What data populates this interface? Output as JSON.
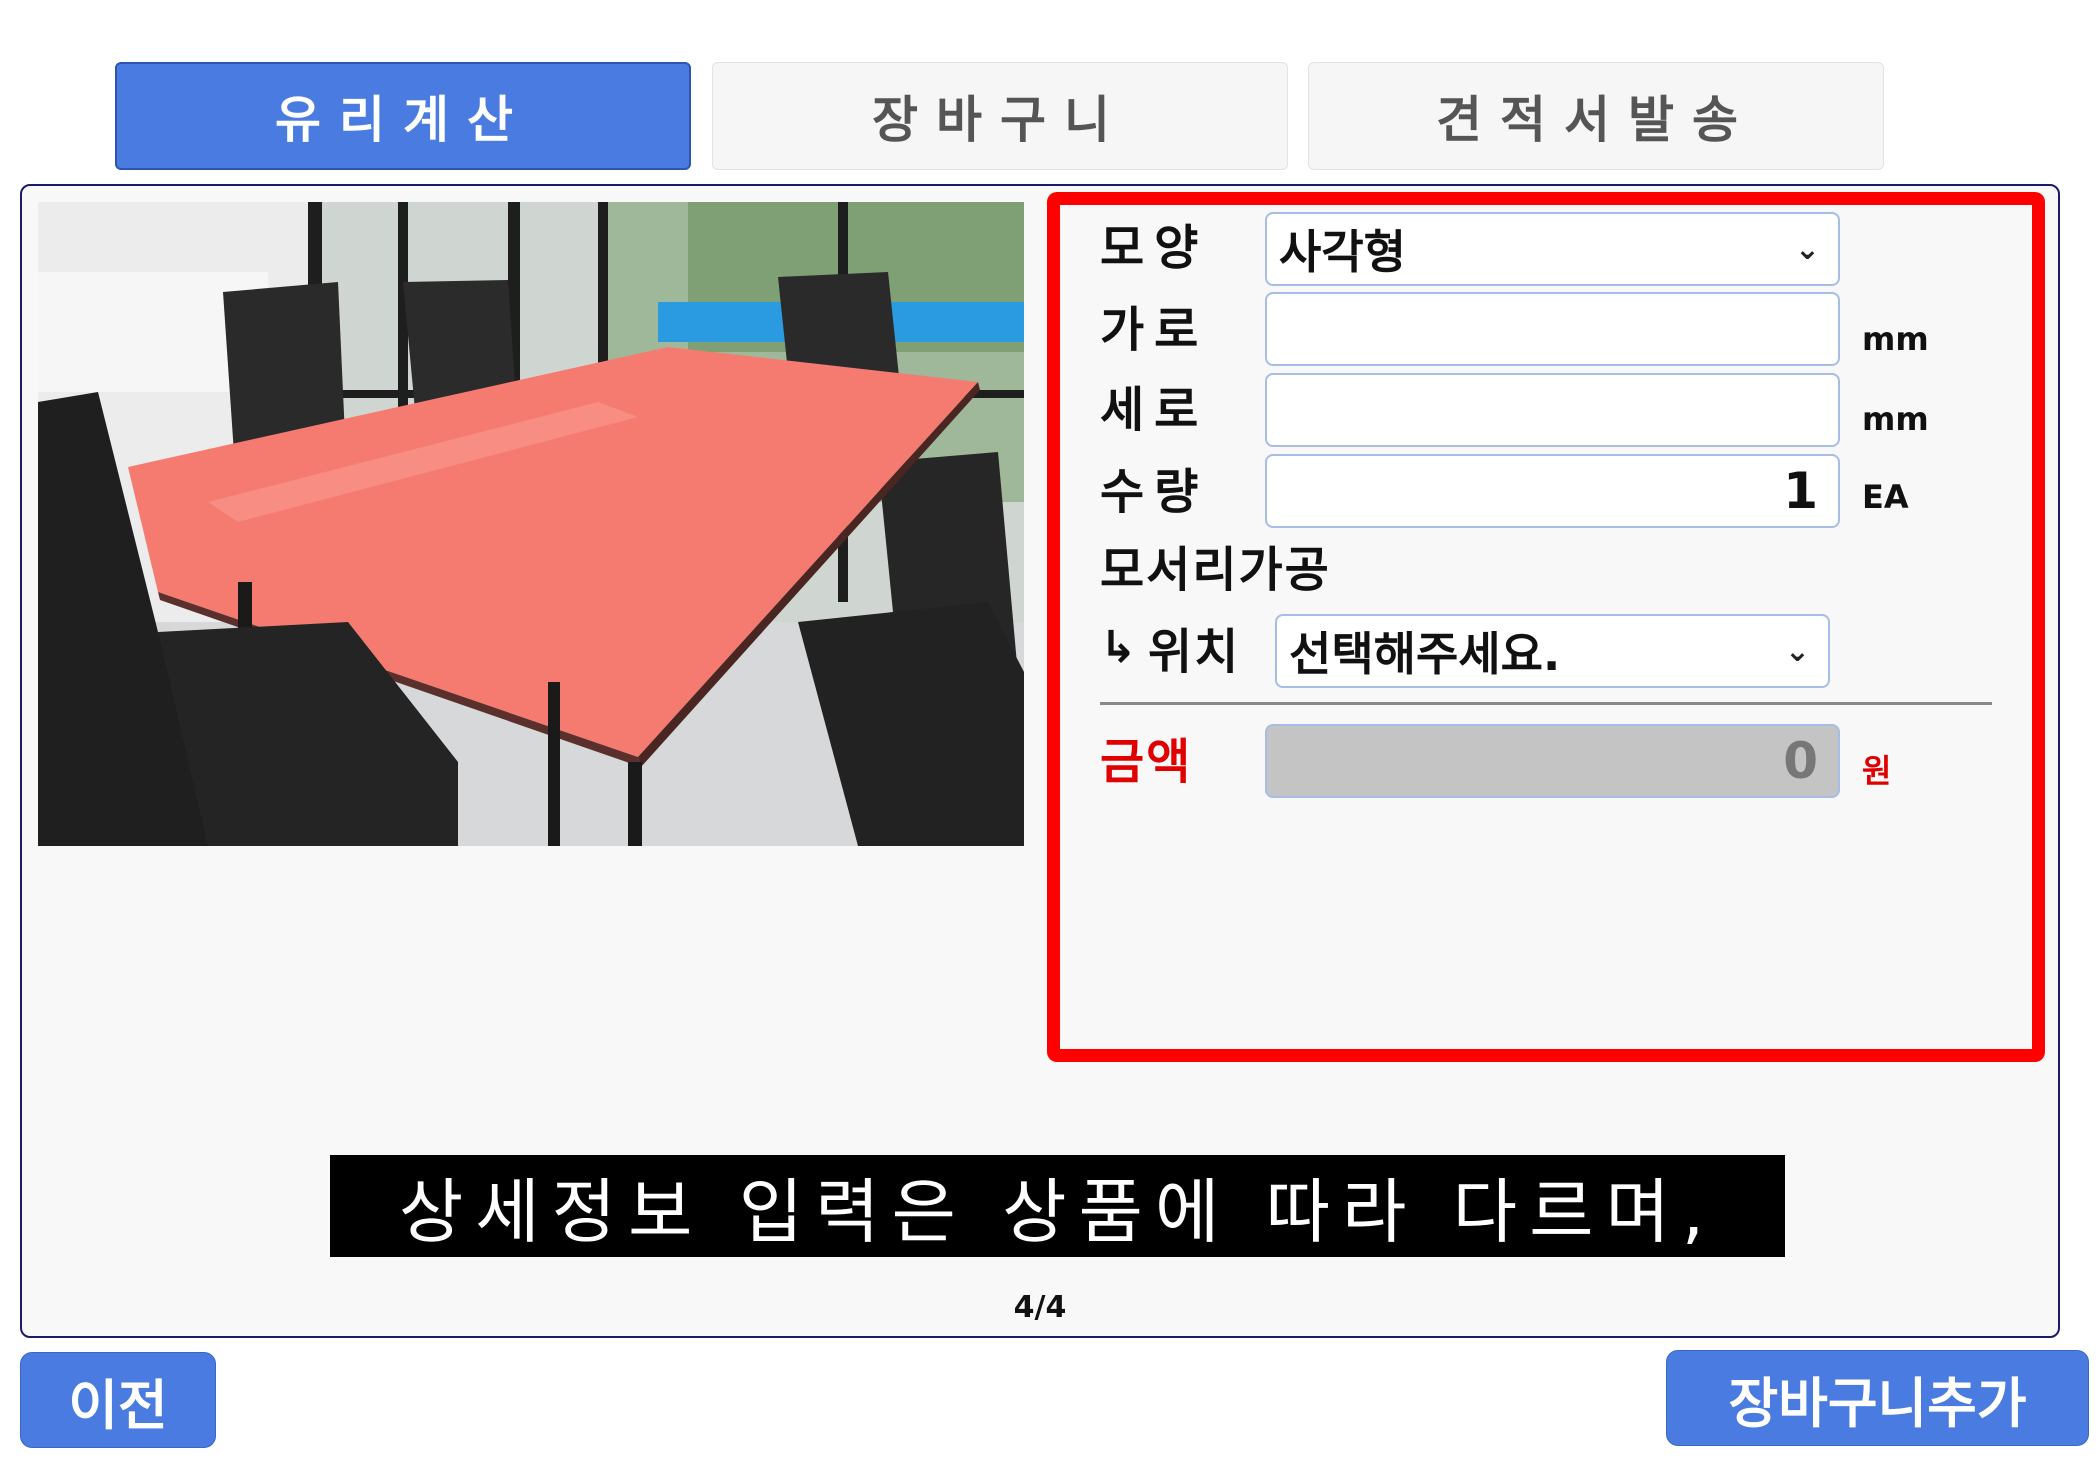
{
  "tabs": [
    {
      "label": "유리계산",
      "active": true
    },
    {
      "label": "장바구니",
      "active": false
    },
    {
      "label": "견적서발송",
      "active": false
    }
  ],
  "photo": {
    "description_icon": "glass-table-photo"
  },
  "form": {
    "shape": {
      "label": "모양",
      "value": "사각형"
    },
    "width": {
      "label": "가로",
      "value": "",
      "unit": "mm"
    },
    "height": {
      "label": "세로",
      "value": "",
      "unit": "mm"
    },
    "quantity": {
      "label": "수량",
      "value": "1",
      "unit": "EA"
    },
    "edge": {
      "label": "모서리가공"
    },
    "position": {
      "arrow": "↳",
      "label": "위치",
      "value": "선택해주세요."
    },
    "price": {
      "label": "금액",
      "value": "0",
      "unit": "원"
    }
  },
  "caption": "상세정보 입력은 상품에 따라 다르며,",
  "pager": "4/4",
  "buttons": {
    "prev": "이전",
    "add_cart": "장바구니추가"
  },
  "colors": {
    "accent": "#4a7be0",
    "highlight": "#ff0000",
    "price": "#e00000",
    "glass": "#f57a70"
  }
}
